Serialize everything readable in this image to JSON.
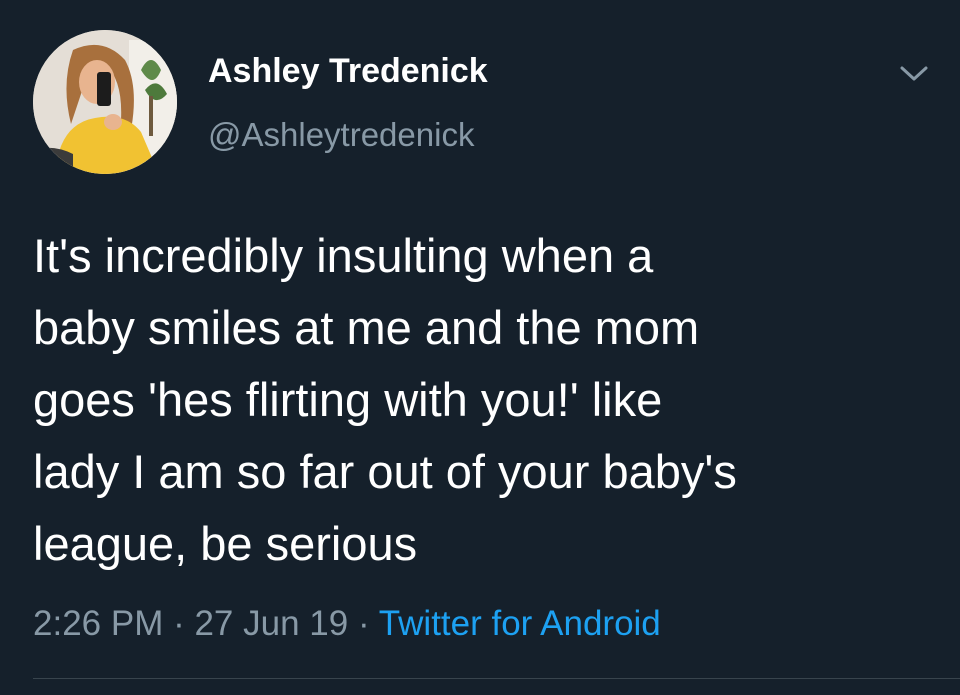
{
  "user": {
    "display_name": "Ashley Tredenick",
    "handle": "@Ashleytredenick"
  },
  "tweet": {
    "lines": [
      "It's incredibly insulting when a",
      "baby smiles at me and the mom",
      "goes 'hes flirting with you!' like",
      "lady I am so far out of your baby's",
      "league, be serious"
    ]
  },
  "meta": {
    "time": "2:26 PM",
    "separator": " · ",
    "date": "27 Jun 19",
    "source": "Twitter for Android"
  },
  "icons": {
    "menu": "chevron-down-icon"
  },
  "colors": {
    "background": "#15202b",
    "text": "#ffffff",
    "secondary": "#8899a6",
    "link": "#1da1f2"
  }
}
